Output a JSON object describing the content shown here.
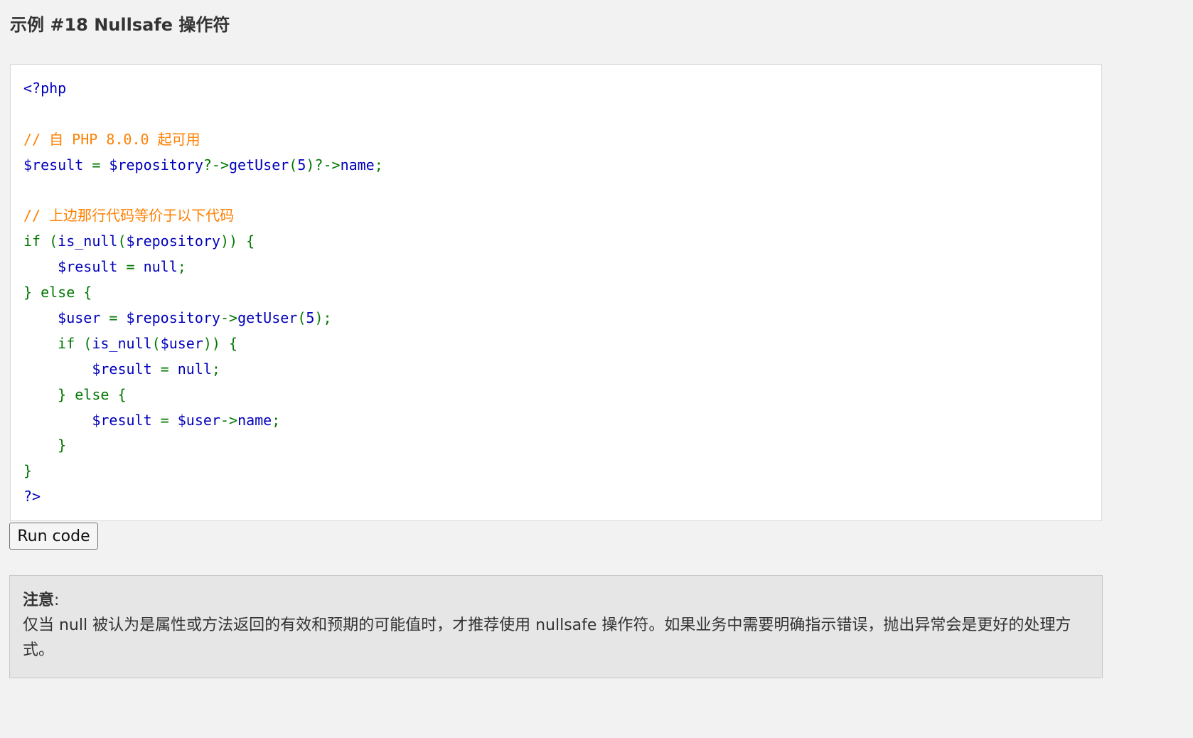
{
  "example": {
    "title": "示例 #18 Nullsafe 操作符"
  },
  "code": {
    "lines": [
      [
        {
          "t": "tag",
          "v": "<?php"
        }
      ],
      [],
      [
        {
          "t": "comment",
          "v": "// 自 PHP 8.0.0 起可用"
        }
      ],
      [
        {
          "t": "var",
          "v": "$result "
        },
        {
          "t": "kw",
          "v": "= "
        },
        {
          "t": "var",
          "v": "$repository"
        },
        {
          "t": "kw",
          "v": "?->"
        },
        {
          "t": "var",
          "v": "getUser"
        },
        {
          "t": "kw",
          "v": "("
        },
        {
          "t": "var",
          "v": "5"
        },
        {
          "t": "kw",
          "v": ")?->"
        },
        {
          "t": "var",
          "v": "name"
        },
        {
          "t": "kw",
          "v": ";"
        }
      ],
      [],
      [
        {
          "t": "comment",
          "v": "// 上边那行代码等价于以下代码"
        }
      ],
      [
        {
          "t": "kw",
          "v": "if ("
        },
        {
          "t": "var",
          "v": "is_null"
        },
        {
          "t": "kw",
          "v": "("
        },
        {
          "t": "var",
          "v": "$repository"
        },
        {
          "t": "kw",
          "v": ")) {"
        }
      ],
      [
        {
          "t": "var",
          "v": "    $result "
        },
        {
          "t": "kw",
          "v": "= "
        },
        {
          "t": "var",
          "v": "null"
        },
        {
          "t": "kw",
          "v": ";"
        }
      ],
      [
        {
          "t": "kw",
          "v": "} else {"
        }
      ],
      [
        {
          "t": "var",
          "v": "    $user "
        },
        {
          "t": "kw",
          "v": "= "
        },
        {
          "t": "var",
          "v": "$repository"
        },
        {
          "t": "kw",
          "v": "->"
        },
        {
          "t": "var",
          "v": "getUser"
        },
        {
          "t": "kw",
          "v": "("
        },
        {
          "t": "var",
          "v": "5"
        },
        {
          "t": "kw",
          "v": ");"
        }
      ],
      [
        {
          "t": "kw",
          "v": "    if ("
        },
        {
          "t": "var",
          "v": "is_null"
        },
        {
          "t": "kw",
          "v": "("
        },
        {
          "t": "var",
          "v": "$user"
        },
        {
          "t": "kw",
          "v": ")) {"
        }
      ],
      [
        {
          "t": "var",
          "v": "        $result "
        },
        {
          "t": "kw",
          "v": "= "
        },
        {
          "t": "var",
          "v": "null"
        },
        {
          "t": "kw",
          "v": ";"
        }
      ],
      [
        {
          "t": "kw",
          "v": "    } else {"
        }
      ],
      [
        {
          "t": "var",
          "v": "        $result "
        },
        {
          "t": "kw",
          "v": "= "
        },
        {
          "t": "var",
          "v": "$user"
        },
        {
          "t": "kw",
          "v": "->"
        },
        {
          "t": "var",
          "v": "name"
        },
        {
          "t": "kw",
          "v": ";"
        }
      ],
      [
        {
          "t": "kw",
          "v": "    }"
        }
      ],
      [
        {
          "t": "kw",
          "v": "}"
        }
      ],
      [
        {
          "t": "tag",
          "v": "?>"
        }
      ]
    ]
  },
  "run_button": {
    "label": "Run code"
  },
  "note": {
    "label": "注意",
    "colon": ":",
    "text": "仅当 null 被认为是属性或方法返回的有效和预期的可能值时，才推荐使用 nullsafe 操作符。如果业务中需要明确指示错误，抛出异常会是更好的处理方式。"
  },
  "colors": {
    "page_background": "#f2f2f2",
    "code_background": "#ffffff",
    "note_background": "#e6e6e6",
    "php_tag": "#0000bb",
    "php_comment": "#ff8000",
    "php_variable": "#0000bb",
    "php_keyword": "#007700"
  }
}
